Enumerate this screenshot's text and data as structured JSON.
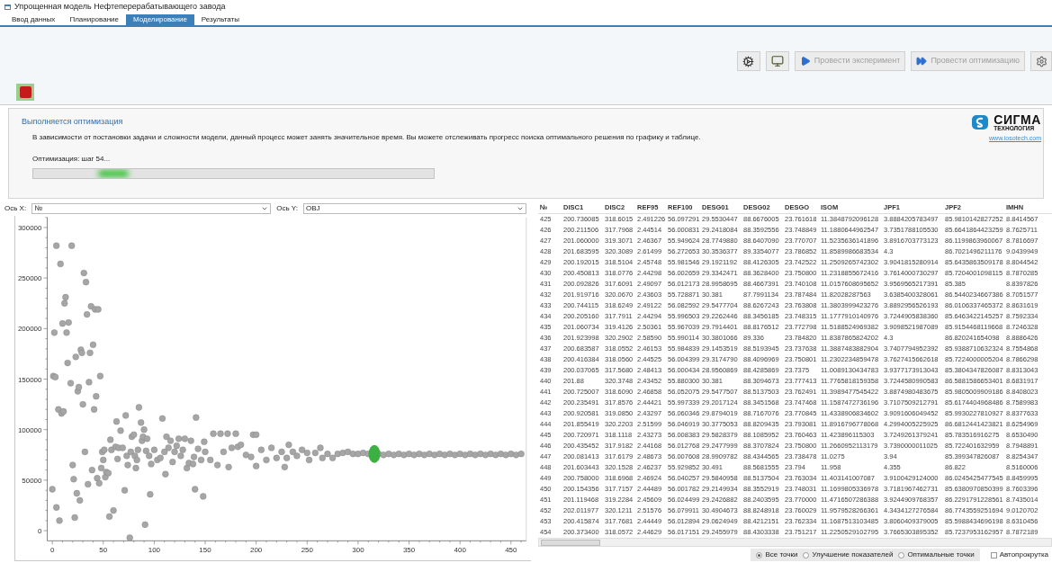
{
  "window": {
    "title": "Упрощенная модель Нефтеперерабатывающего завода"
  },
  "tabs": [
    {
      "label": "Ввод данных",
      "selected": false
    },
    {
      "label": "Планирование",
      "selected": false
    },
    {
      "label": "Моделирование",
      "selected": true
    },
    {
      "label": "Результаты",
      "selected": false
    }
  ],
  "toolbar": {
    "buttons": [
      {
        "kind": "gear",
        "disabled": false
      },
      {
        "kind": "monitor",
        "disabled": false
      },
      {
        "kind": "run",
        "label": "Провести эксперимент",
        "disabled": true
      },
      {
        "kind": "optimize",
        "label": "Провести оптимизацию",
        "disabled": true
      },
      {
        "kind": "settings",
        "disabled": false
      }
    ]
  },
  "status_panel": {
    "title": "Выполняется оптимизация",
    "description": "В зависимости от постановки задачи и сложности модели, данный процесс может занять значительное время. Вы можете отслеживать прогресс поиска оптимального решения по графику и таблице.",
    "progress_label": "Оптимизация: шаг 54...",
    "level": 0.2
  },
  "logo": {
    "name": "СИГМА",
    "subtitle": "ТЕХНОЛОГИЯ",
    "link": "www.iosotech.com"
  },
  "axis_selectors": [
    {
      "label": "Ось X:",
      "value": "№"
    },
    {
      "label": "Ось Y:",
      "value": "OBJ"
    }
  ],
  "chart": {
    "chart_data": {
      "type": "scatter",
      "xlim": [
        -5,
        465
      ],
      "ylim": [
        -10000,
        310000
      ],
      "xticks": [
        0,
        50,
        100,
        150,
        200,
        250,
        300,
        350,
        400,
        450
      ],
      "yticks": [
        0,
        50000,
        100000,
        150000,
        200000,
        250000,
        300000
      ],
      "x": [
        0,
        1,
        2,
        3,
        4,
        4,
        6,
        7,
        8,
        9,
        10,
        11,
        12,
        13,
        14,
        15,
        16,
        18,
        19,
        20,
        21,
        22,
        23,
        24,
        25,
        26,
        27,
        28,
        29,
        30,
        31,
        32,
        33,
        34,
        35,
        36,
        37,
        38,
        39,
        40,
        41,
        42,
        43,
        44,
        45,
        46,
        47,
        48,
        49,
        50,
        51,
        52,
        53,
        55,
        56,
        57,
        58,
        60,
        62,
        63,
        64,
        65,
        67,
        69,
        71,
        72,
        73,
        74,
        76,
        77,
        78,
        80,
        81,
        82,
        83,
        84,
        85,
        87,
        88,
        89,
        90,
        91,
        92,
        93,
        95,
        96,
        97,
        100,
        103,
        106,
        108,
        110,
        111,
        112,
        114,
        116,
        118,
        120,
        122,
        124,
        126,
        128,
        130,
        132,
        134,
        136,
        138,
        139,
        140,
        141,
        143,
        146,
        148,
        149,
        150,
        155,
        158,
        162,
        165,
        168,
        172,
        173,
        176,
        180,
        182,
        185,
        190,
        195,
        197,
        200,
        200,
        205,
        210,
        215,
        220,
        225,
        228,
        230,
        232,
        236,
        240,
        245,
        250,
        252,
        258,
        263,
        265,
        270,
        275,
        280,
        285,
        290,
        295,
        300,
        305,
        310,
        316,
        320,
        325,
        330,
        335,
        340,
        345,
        350,
        355,
        360,
        365,
        370,
        375,
        380,
        385,
        390,
        395,
        400,
        405,
        410,
        415,
        420,
        425,
        430,
        435,
        440,
        445,
        450,
        455,
        460
      ],
      "series": [
        {
          "color": "#a6a6a6",
          "values": [
            41000,
            153000,
            196000,
            152000,
            23000,
            282000,
            120000,
            10000,
            264000,
            116000,
            205000,
            118000,
            225000,
            231000,
            196000,
            166000,
            206000,
            146000,
            282000,
            65000,
            51000,
            13000,
            172000,
            37000,
            138000,
            142000,
            30000,
            179000,
            176000,
            125000,
            255000,
            78000,
            246000,
            214000,
            46000,
            147000,
            176000,
            222000,
            60000,
            184000,
            120000,
            219000,
            133000,
            52000,
            219000,
            47000,
            153000,
            62000,
            78000,
            70000,
            80000,
            53000,
            58000,
            57000,
            14000,
            90000,
            80000,
            20000,
            83000,
            108000,
            71000,
            82000,
            99000,
            82000,
            40000,
            114000,
            74000,
            65000,
            -7000,
            78000,
            93000,
            95000,
            74000,
            62000,
            70000,
            80000,
            122000,
            107000,
            89000,
            93000,
            100000,
            6000,
            79000,
            91000,
            74000,
            36000,
            66000,
            80000,
            70000,
            72000,
            111000,
            78000,
            56000,
            93000,
            82000,
            89000,
            68000,
            78000,
            84000,
            91000,
            74000,
            80000,
            91000,
            62000,
            67000,
            89000,
            66000,
            73000,
            41000,
            112000,
            81000,
            70000,
            34000,
            88000,
            78000,
            70000,
            96000,
            65000,
            96000,
            78000,
            96000,
            63000,
            82000,
            96000,
            83000,
            85000,
            75000,
            73000,
            95000,
            64000,
            95000,
            80000,
            70000,
            82000,
            72000,
            78000,
            63000,
            72000,
            85000,
            78000,
            74000,
            80000,
            77000,
            70000,
            77000,
            82000,
            72000,
            76000,
            72000,
            76000,
            77000,
            78000,
            76000,
            76000,
            77000,
            76000,
            null,
            76000,
            75000,
            76000,
            75000,
            76000,
            75000,
            76000,
            75000,
            76000,
            75000,
            76000,
            75000,
            76000,
            75000,
            76000,
            75000,
            76000,
            75000,
            76000,
            75000,
            76000,
            75000,
            76000,
            75000,
            76000,
            75000,
            76000,
            75000,
            76000
          ]
        },
        {
          "color": "#3cb043",
          "values": [
            null,
            null,
            null,
            null,
            null,
            null,
            null,
            null,
            null,
            null,
            null,
            null,
            null,
            null,
            null,
            null,
            null,
            null,
            null,
            null,
            null,
            null,
            null,
            null,
            null,
            null,
            null,
            null,
            null,
            null,
            null,
            null,
            null,
            null,
            null,
            null,
            null,
            null,
            null,
            null,
            null,
            null,
            null,
            null,
            null,
            null,
            null,
            null,
            null,
            null,
            null,
            null,
            null,
            null,
            null,
            null,
            null,
            null,
            null,
            null,
            null,
            null,
            null,
            null,
            null,
            null,
            null,
            null,
            null,
            null,
            null,
            null,
            null,
            null,
            null,
            null,
            null,
            null,
            null,
            null,
            null,
            null,
            null,
            null,
            null,
            null,
            null,
            null,
            null,
            null,
            null,
            null,
            null,
            null,
            null,
            null,
            null,
            null,
            null,
            null,
            null,
            null,
            null,
            null,
            null,
            null,
            null,
            null,
            null,
            null,
            null,
            null,
            null,
            null,
            null,
            null,
            null,
            null,
            null,
            null,
            null,
            null,
            null,
            null,
            null,
            null,
            null,
            null,
            null,
            null,
            null,
            null,
            null,
            null,
            null,
            null,
            null,
            null,
            null,
            null,
            null,
            null,
            null,
            null,
            null,
            null,
            null,
            null,
            null,
            null,
            null,
            null,
            null,
            null,
            null,
            null,
            76000,
            null,
            null,
            null,
            null,
            null,
            null,
            null,
            null,
            null,
            null,
            null,
            null,
            null,
            null,
            null,
            null,
            null,
            null,
            null,
            null,
            null,
            null,
            null,
            null,
            null,
            null,
            null,
            null,
            null
          ]
        }
      ]
    }
  },
  "table": {
    "columns": [
      "№",
      "DISC1",
      "DISC2",
      "REF95",
      "REF100",
      "DESG01",
      "DESG02",
      "DESGO",
      "ISOM",
      "JPF1",
      "JPF2",
      "IMHN"
    ],
    "rows": [
      [
        "425",
        "200.736085",
        "318.6015",
        "2.491226",
        "56.097291",
        "29.5530447",
        "88.6676005",
        "23.761618",
        "11.3848792096128",
        "3.8884205783497",
        "85.9810142827252",
        "8.8414567"
      ],
      [
        "426",
        "200.211506",
        "317.7968",
        "2.44514",
        "56.000831",
        "29.2418084",
        "88.3592556",
        "23.748849",
        "11.1880644962547",
        "3.7351788105530",
        "85.6641864423259",
        "8.7625711"
      ],
      [
        "427",
        "201.060000",
        "319.3071",
        "2.46367",
        "55.949624",
        "28.7749880",
        "88.6407090",
        "23.770707",
        "11.5235636141896",
        "3.8916703773123",
        "86.1199863960067",
        "8.7816697"
      ],
      [
        "428",
        "201.683595",
        "320.3089",
        "2.61499",
        "56.272653",
        "30.3536377",
        "89.3354077",
        "23.786852",
        "11.8589986683534",
        "4.3",
        "86.7021496211176",
        "9.0439949"
      ],
      [
        "429",
        "200.192015",
        "318.5104",
        "2.45748",
        "55.981546",
        "29.1921192",
        "88.4126305",
        "23.742522",
        "11.2509265742302",
        "3.9041815280914",
        "85.6435863509178",
        "8.8044542"
      ],
      [
        "430",
        "200.450813",
        "318.0776",
        "2.44298",
        "56.002659",
        "29.3342471",
        "88.3628400",
        "23.750800",
        "11.2318855672416",
        "3.7614000730297",
        "85.7204001098115",
        "8.7870285"
      ],
      [
        "431",
        "200.092826",
        "317.6091",
        "2.49097",
        "56.012173",
        "28.9958695",
        "88.4667391",
        "23.740108",
        "11.0157608695652",
        "3.9569565217391",
        "85.385",
        "8.8397826"
      ],
      [
        "432",
        "201.919716",
        "320.0670",
        "2.43603",
        "55.728871",
        "30.381",
        "87.7991134",
        "23.787484",
        "11.82028287563",
        "3.6385400328061",
        "86.5440234667386",
        "8.7051577"
      ],
      [
        "433",
        "200.744115",
        "318.6249",
        "2.49122",
        "56.082592",
        "29.5477704",
        "88.6267243",
        "23.763808",
        "11.3803999423276",
        "3.8892956526193",
        "86.0106337465372",
        "8.8631619"
      ],
      [
        "434",
        "200.205160",
        "317.7911",
        "2.44294",
        "55.996503",
        "29.2262446",
        "88.3456185",
        "23.748315",
        "11.1777910140976",
        "3.7244905838360",
        "85.6463422145257",
        "8.7592334"
      ],
      [
        "435",
        "201.060734",
        "319.4126",
        "2.50361",
        "55.967039",
        "29.7914401",
        "88.8176512",
        "23.772798",
        "11.5188524969382",
        "3.9098521987089",
        "85.9154468119668",
        "8.7246328"
      ],
      [
        "436",
        "201.923998",
        "320.2902",
        "2.58590",
        "55.990114",
        "30.3801066",
        "89.336",
        "23.784820",
        "11.8387865824202",
        "4.3",
        "86.820241654098",
        "8.8886426"
      ],
      [
        "437",
        "200.683587",
        "318.0552",
        "2.46153",
        "55.984839",
        "29.1453519",
        "88.5193945",
        "23.737638",
        "11.3887483882904",
        "3.7407794952392",
        "85.9388710632324",
        "8.7554868"
      ],
      [
        "438",
        "200.416384",
        "318.0560",
        "2.44525",
        "56.004399",
        "29.3174790",
        "88.4096969",
        "23.750801",
        "11.2302234859478",
        "3.7627415662618",
        "85.7224000005204",
        "8.7866298"
      ],
      [
        "439",
        "200.037065",
        "317.5680",
        "2.48413",
        "56.000434",
        "28.9560869",
        "88.4285869",
        "23.7375",
        "11.0089130434783",
        "3.9377173913043",
        "85.3804347826087",
        "8.8313043"
      ],
      [
        "440",
        "201.88",
        "320.3748",
        "2.43452",
        "55.880300",
        "30.381",
        "88.3094673",
        "23.777413",
        "11.7765818159358",
        "3.7244580990583",
        "86.5881586653401",
        "8.6831917"
      ],
      [
        "441",
        "200.725007",
        "318.6090",
        "2.46858",
        "56.052075",
        "29.5477507",
        "88.5137503",
        "23.762491",
        "11.3989477545422",
        "3.8874980483675",
        "85.9805009909186",
        "8.8408023"
      ],
      [
        "442",
        "200.235491",
        "317.8576",
        "2.44421",
        "55.997339",
        "29.2017124",
        "88.3451568",
        "23.747468",
        "11.1587472736196",
        "3.7107509212791",
        "85.6174404968486",
        "8.7589983"
      ],
      [
        "443",
        "200.920581",
        "319.0850",
        "2.43297",
        "56.060346",
        "29.8794019",
        "88.7167076",
        "23.770845",
        "11.4338906834602",
        "3.9091606049452",
        "85.9930227810927",
        "8.8377633"
      ],
      [
        "444",
        "201.855419",
        "320.2203",
        "2.51599",
        "56.046919",
        "30.3775053",
        "88.8209435",
        "23.793081",
        "11.8916796778068",
        "4.2994005225925",
        "86.6812441423821",
        "8.6254969"
      ],
      [
        "445",
        "200.720971",
        "318.1118",
        "2.43273",
        "56.008383",
        "29.5828379",
        "88.1085952",
        "23.760463",
        "11.423896115303",
        "3.7249261379241",
        "85.783516916275",
        "8.6530490"
      ],
      [
        "446",
        "200.435452",
        "317.9182",
        "2.44168",
        "56.012768",
        "29.2477999",
        "88.3707824",
        "23.750800",
        "11.2660952113179",
        "3.7390000011025",
        "85.722401632959",
        "8.7948891"
      ],
      [
        "447",
        "200.081413",
        "317.6179",
        "2.48673",
        "56.007608",
        "28.9909782",
        "88.4344565",
        "23.738478",
        "11.0275",
        "3.94",
        "85.399347826087",
        "8.8254347"
      ],
      [
        "448",
        "201.603443",
        "320.1528",
        "2.46237",
        "55.929852",
        "30.491",
        "88.5681555",
        "23.794",
        "11.958",
        "4.355",
        "86.822",
        "8.5160006"
      ],
      [
        "449",
        "200.758000",
        "318.6968",
        "2.46924",
        "56.040257",
        "29.5840958",
        "88.5137504",
        "23.763034",
        "11.403141007087",
        "3.9100429124000",
        "86.0245425477545",
        "8.8459995"
      ],
      [
        "450",
        "200.154356",
        "317.7157",
        "2.44489",
        "56.001782",
        "29.2149934",
        "88.3552919",
        "23.748031",
        "11.1699805336978",
        "3.7181967462731",
        "85.6380970850399",
        "8.7603396"
      ],
      [
        "451",
        "201.119468",
        "319.2284",
        "2.45609",
        "56.024499",
        "29.2426882",
        "88.2403595",
        "23.770000",
        "11.4716507286388",
        "3.9244909768357",
        "86.2291791228561",
        "8.7435014"
      ],
      [
        "452",
        "202.011977",
        "320.1211",
        "2.51576",
        "56.079911",
        "30.4904673",
        "88.8248918",
        "23.760029",
        "11.9579528266361",
        "4.3434127276584",
        "86.7743559251694",
        "9.0120702"
      ],
      [
        "453",
        "200.415874",
        "317.7681",
        "2.44449",
        "56.012894",
        "29.0624949",
        "88.4212151",
        "23.762334",
        "11.1687513103485",
        "3.8060409379005",
        "85.5988434696198",
        "8.6310456"
      ],
      [
        "454",
        "200.373400",
        "318.0572",
        "2.44629",
        "56.017151",
        "29.2455979",
        "88.4303338",
        "23.751217",
        "11.2250529102795",
        "3.7665303895352",
        "85.7237953162957",
        "8.7872189"
      ]
    ]
  },
  "view_options": [
    {
      "label": "Все точки",
      "selected": true
    },
    {
      "label": "Улучшение показателей",
      "selected": false
    },
    {
      "label": "Оптимальные точки",
      "selected": false
    }
  ],
  "autoscroll": {
    "label": "Автопрокрутка",
    "checked": false
  }
}
